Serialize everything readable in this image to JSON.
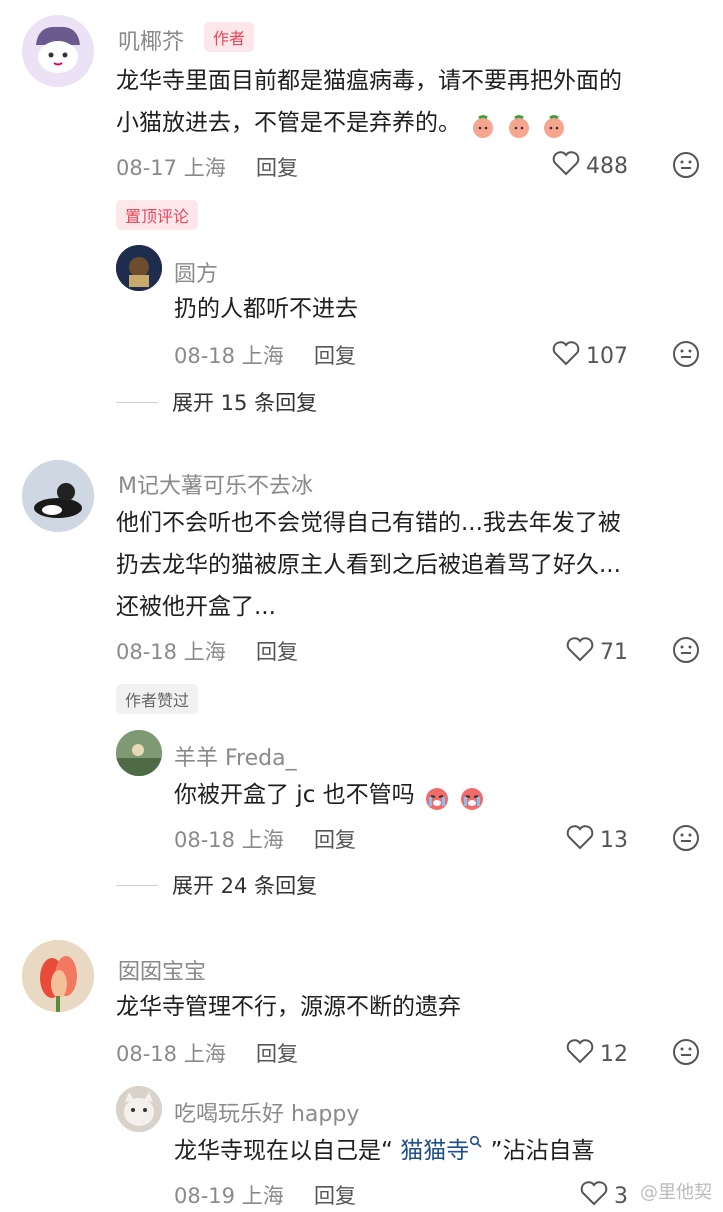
{
  "comments": [
    {
      "username": "叽椰芥",
      "badge": "作者",
      "lines": [
        "龙华寺里面目前都是猫瘟病毒，请不要再把外面的",
        "小猫放进去，不管是不是弃养的。"
      ],
      "date": "08-17",
      "location": "上海",
      "reply_label": "回复",
      "likes": "488",
      "pinned_tag": "置顶评论",
      "replies": [
        {
          "username": "圆方",
          "text": "扔的人都听不进去",
          "date": "08-18",
          "location": "上海",
          "reply_label": "回复",
          "likes": "107"
        }
      ],
      "expand_label": "展开 15 条回复"
    },
    {
      "username": "M记大薯可乐不去冰",
      "lines": [
        "他们不会听也不会觉得自己有错的...我去年发了被",
        "扔去龙华的猫被原主人看到之后被追着骂了好久...",
        "还被他开盒了..."
      ],
      "date": "08-18",
      "location": "上海",
      "reply_label": "回复",
      "likes": "71",
      "liked_tag": "作者赞过",
      "replies": [
        {
          "username": "羊羊 Freda_",
          "text": "你被开盒了 jc 也不管吗",
          "date": "08-18",
          "location": "上海",
          "reply_label": "回复",
          "likes": "13"
        }
      ],
      "expand_label": "展开 24 条回复"
    },
    {
      "username": "囡囡宝宝",
      "lines": [
        "龙华寺管理不行，源源不断的遗弃"
      ],
      "date": "08-18",
      "location": "上海",
      "reply_label": "回复",
      "likes": "12",
      "replies": [
        {
          "username": "吃喝玩乐好 happy",
          "text_before": "龙华寺现在以自己是“ ",
          "hashtag": "猫猫寺",
          "text_after": " ”沾沾自喜",
          "date": "08-19",
          "location": "上海",
          "reply_label": "回复",
          "likes": "3"
        }
      ]
    }
  ],
  "watermark": "@里他契",
  "icons": {
    "heart": "heart-outline-icon",
    "reply_emoji": "smiley-face-icon",
    "cry_emoji": "crying-emoji-icon",
    "peach_emoji": "peach-emoji-icon",
    "search_small": "search-icon"
  },
  "colors": {
    "author_badge_bg": "#fde7ea",
    "author_badge_text": "#e8465b",
    "pinned_bg": "#fde7ea",
    "pinned_text": "#e8465b",
    "liked_tag_bg": "#f1f1f1",
    "liked_tag_text": "#666666"
  }
}
